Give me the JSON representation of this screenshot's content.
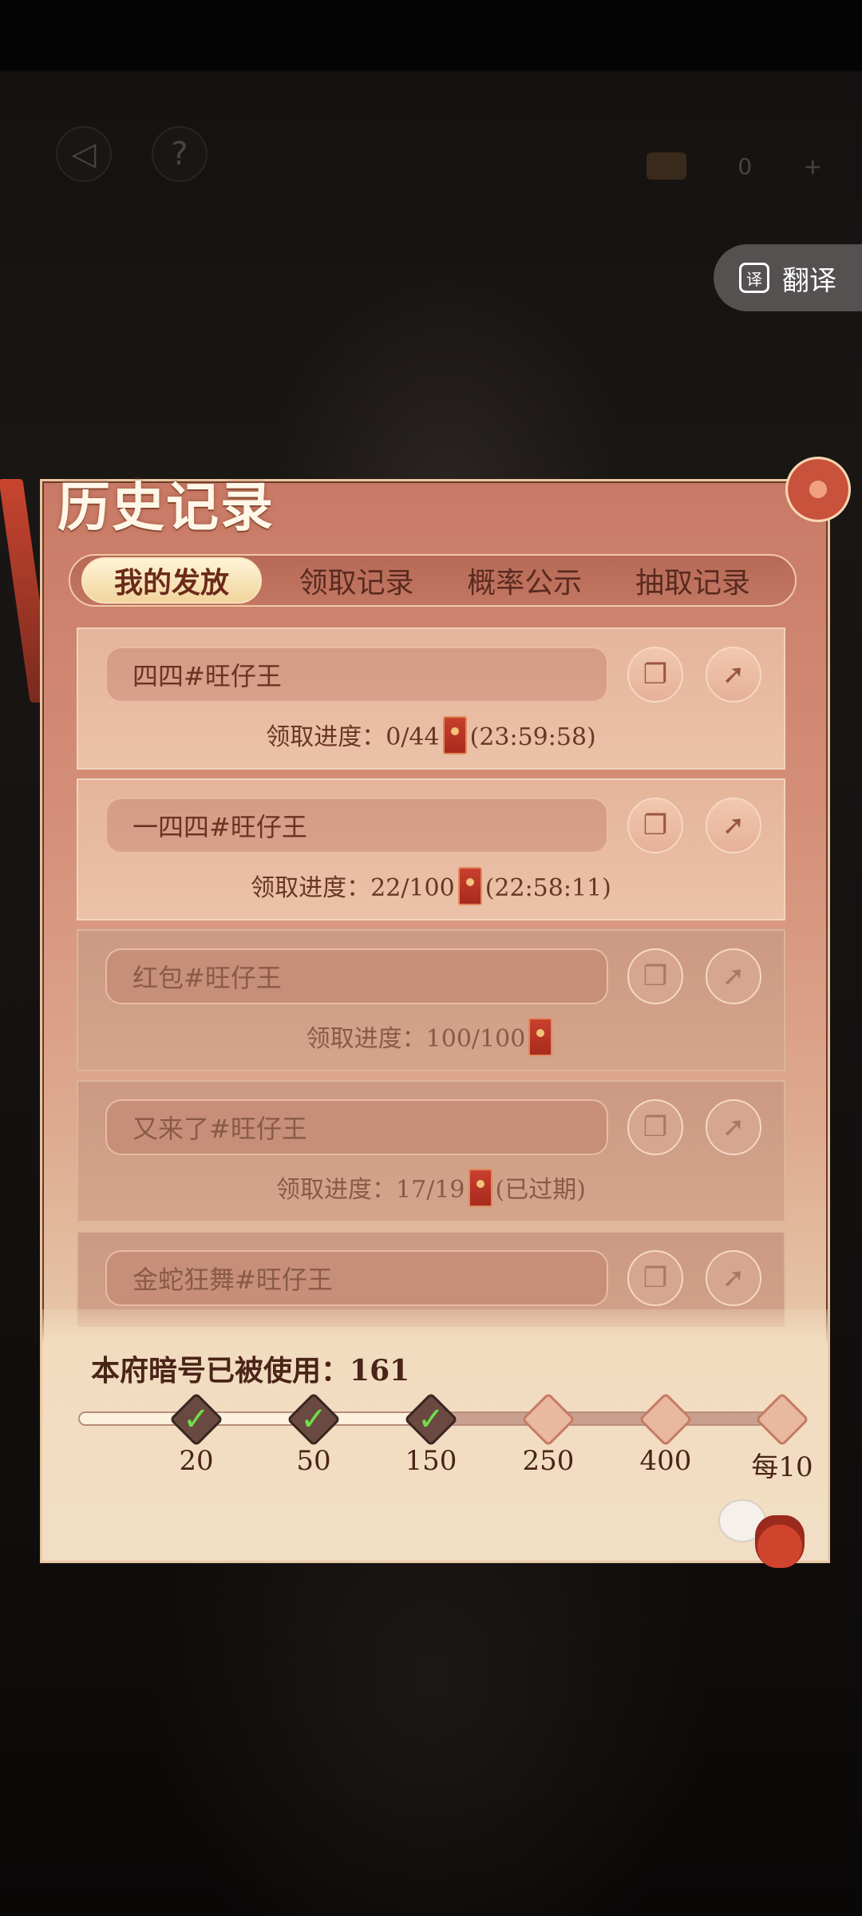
{
  "top_bar": {
    "back_icon": "back-arrow-icon",
    "help_icon": "question-icon",
    "currency_value": "0",
    "plus_label": "+"
  },
  "translate": {
    "label": "翻译",
    "icon": "translate-icon"
  },
  "panel": {
    "title": "历史记录"
  },
  "tabs": [
    {
      "label": "我的发放",
      "active": true
    },
    {
      "label": "领取记录",
      "active": false
    },
    {
      "label": "概率公示",
      "active": false
    },
    {
      "label": "抽取记录",
      "active": false
    }
  ],
  "records": [
    {
      "name": "四四#旺仔王",
      "progress_label": "领取进度：",
      "progress": "0/44",
      "extra": "(23:59:58)",
      "expired": false
    },
    {
      "name": "一四四#旺仔王",
      "progress_label": "领取进度：",
      "progress": "22/100",
      "extra": "(22:58:11)",
      "expired": false
    },
    {
      "name": "红包#旺仔王",
      "progress_label": "领取进度：",
      "progress": "100/100",
      "extra": "",
      "expired": true
    },
    {
      "name": "又来了#旺仔王",
      "progress_label": "领取进度：",
      "progress": "17/19",
      "extra": "(已过期)",
      "expired": true
    },
    {
      "name": "金蛇狂舞#旺仔王",
      "progress_label": "",
      "progress": "",
      "extra": "",
      "expired": true
    }
  ],
  "usage": {
    "label": "本府暗号已被使用：",
    "value": "161"
  },
  "milestones": [
    {
      "label": "20",
      "done": true
    },
    {
      "label": "50",
      "done": true
    },
    {
      "label": "150",
      "done": true
    },
    {
      "label": "250",
      "done": false
    },
    {
      "label": "400",
      "done": false
    },
    {
      "label": "每10",
      "done": false
    }
  ],
  "progress_fraction": 0.47,
  "colors": {
    "panel_top": "#c97a66",
    "panel_bottom": "#f0dcc0",
    "accent_red": "#c9402e",
    "check_green": "#6fe04a"
  }
}
